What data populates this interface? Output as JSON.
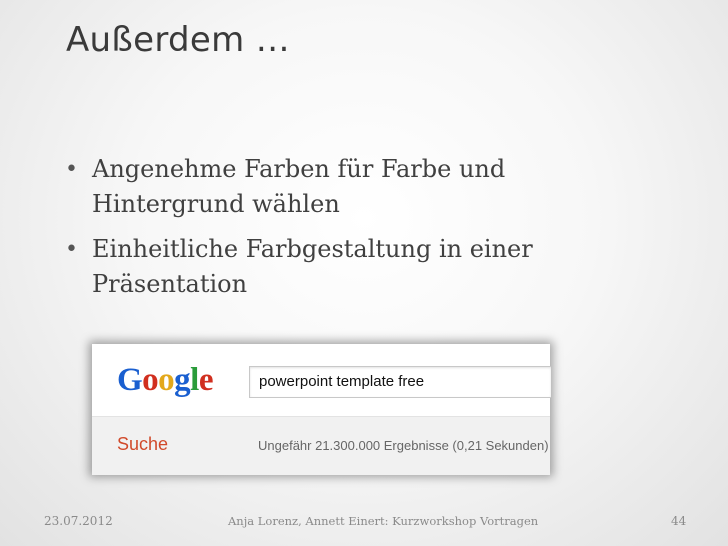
{
  "slide": {
    "title": "Außerdem …",
    "bullets": [
      {
        "text": "Angenehme Farben für Farbe und Hintergrund wählen"
      },
      {
        "text": "Einheitliche Farbgestaltung in einer Präsentation"
      }
    ],
    "bullet_symbol": "•"
  },
  "screenshot": {
    "logo": {
      "letters": [
        "G",
        "o",
        "o",
        "g",
        "l",
        "e"
      ],
      "colors": [
        "#1a5fd0",
        "#d12f1f",
        "#e3a81b",
        "#1a5fd0",
        "#2a9c3a",
        "#d12f1f"
      ]
    },
    "search_query": "powerpoint template free",
    "section_label": "Suche",
    "result_stats": "Ungefähr 21.300.000 Ergebnisse (0,21 Sekunden)"
  },
  "footer": {
    "date": "23.07.2012",
    "authors": "Anja Lorenz, Annett Einert: Kurzworkshop Vortragen",
    "page_number": "44"
  }
}
